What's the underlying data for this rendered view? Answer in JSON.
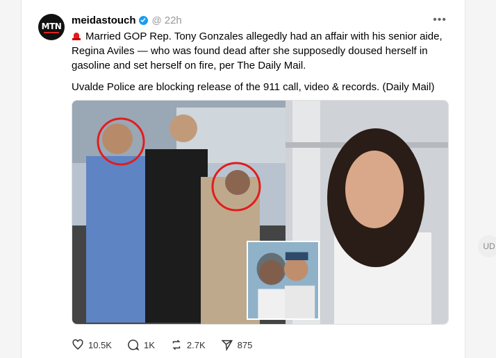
{
  "post": {
    "avatar_text": "MTN",
    "username": "meidastouch",
    "time": "22h",
    "paragraph1": "Married GOP Rep. Tony Gonzales allegedly had an affair with his senior aide, Regina Aviles — who was found dead after she supposedly doused herself in gasoline and set herself on fire, per The Daily Mail.",
    "paragraph2": "Uvalde Police are blocking release of the 911 call, video & records. (Daily Mail)",
    "more_label": "•••"
  },
  "actions": {
    "likes": "10.5K",
    "comments": "1K",
    "reposts": "2.7K",
    "shares": "875"
  },
  "side": {
    "label": "UD"
  },
  "colors": {
    "verified": "#1d9bf0",
    "circle_highlight": "#e11d1d",
    "siren": "#e11d1d"
  }
}
